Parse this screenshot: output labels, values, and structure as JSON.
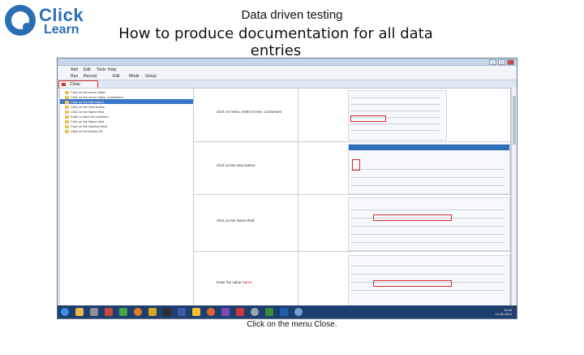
{
  "logo": {
    "line1": "Click",
    "line2": "Learn"
  },
  "header": {
    "title_small": "Data driven testing",
    "title_big": "How to produce documentation for all data entries"
  },
  "caption": {
    "prefix": "Click on the menu ",
    "emphasis": "Close",
    "suffix": "."
  },
  "window": {
    "menu": [
      "Add",
      "Edit",
      "Tools",
      "Help"
    ],
    "toolbar": [
      "Run",
      "Record",
      "Edit",
      "Mode",
      "Group"
    ],
    "close_label": "Close"
  },
  "tree": {
    "items": [
      "Click on the menu Sales",
      "Click on the menu Sales, Customers",
      "Click on the edit button",
      "Click on the New button",
      "Click on the Name field",
      "Enter a value for customer",
      "Click on the Name field",
      "Click on the Number field",
      "Click on the button OK"
    ]
  },
  "doc": {
    "steps": [
      {
        "text": "Click on menu, select Home, Customers",
        "red": ""
      },
      {
        "text": "Click on the New button",
        "red": ""
      },
      {
        "text": "Click on the Name field",
        "red": ""
      },
      {
        "text": "Enter the value ",
        "red": "Name"
      }
    ]
  },
  "taskbar": {
    "time": "10:45",
    "date": "12-05-2014"
  },
  "colors": {
    "brand": "#2a6fb5",
    "highlight": "#d23030",
    "taskbar": "#1e3f6e"
  }
}
